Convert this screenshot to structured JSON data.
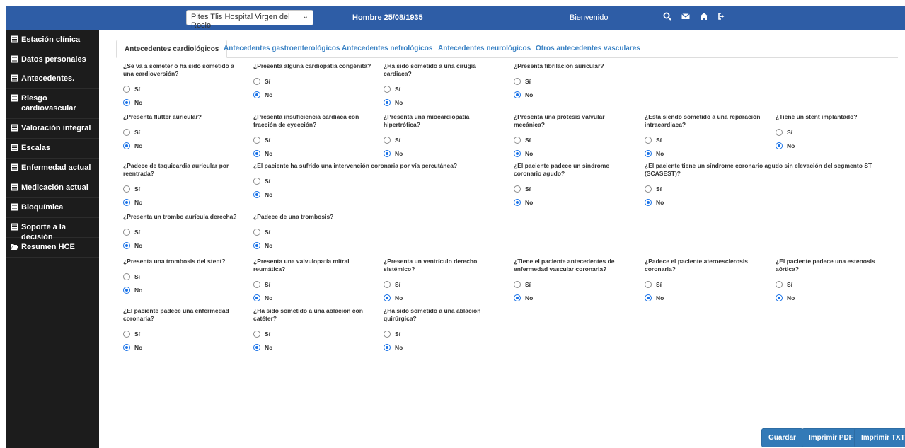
{
  "header": {
    "hospital_select": "Pites Tlis Hospital Virgen del Rocio",
    "patient": "Hombre 25/08/1935",
    "welcome": "Bienvenido",
    "icons": [
      "search-icon",
      "envelope-icon",
      "home-icon",
      "logout-icon"
    ]
  },
  "sidebar": {
    "items": [
      {
        "label": "Estación clínica"
      },
      {
        "label": "Datos personales"
      },
      {
        "label": "Antecedentes."
      },
      {
        "label": "Riesgo cardiovascular"
      },
      {
        "label": "Valoración integral"
      },
      {
        "label": "Escalas"
      },
      {
        "label": "Enfermedad actual"
      },
      {
        "label": "Medicación actual"
      },
      {
        "label": "Bioquímica"
      },
      {
        "label": "Soporte a la decisión"
      },
      {
        "label": "Resumen HCE"
      }
    ]
  },
  "tabs": [
    {
      "label": "Antecedentes cardiológicos",
      "active": true
    },
    {
      "label": "Antecedentes gastroenterológicos",
      "active": false
    },
    {
      "label": "Antecedentes nefrológicos",
      "active": false
    },
    {
      "label": "Antecedentes neurológicos",
      "active": false
    },
    {
      "label": "Otros antecedentes vasculares",
      "active": false
    }
  ],
  "options": {
    "yes": "Sí",
    "no": "No"
  },
  "questions": [
    {
      "text": "¿Se va a someter o ha sido sometido a una cardioversión?",
      "value": "No"
    },
    {
      "text": "¿Presenta alguna cardiopatía congénita?",
      "value": "No"
    },
    {
      "text": "¿Ha sido sometido a una cirugía cardiaca?",
      "value": "No"
    },
    {
      "text": "¿Presenta fibrilación auricular?",
      "value": "No"
    },
    {
      "text": "¿Presenta flutter auricular?",
      "value": "No"
    },
    {
      "text": "¿Presenta insuficiencia cardiaca con fracción de eyección?",
      "value": "No"
    },
    {
      "text": "¿Presenta una miocardiopatía hipertrófica?",
      "value": "No"
    },
    {
      "text": "¿Presenta una prótesis valvular mecánica?",
      "value": "No"
    },
    {
      "text": "¿Está siendo sometido a una reparación intracardiaca?",
      "value": "No"
    },
    {
      "text": "¿Tiene un stent implantado?",
      "value": "No"
    },
    {
      "text": "¿Padece de taquicardia auricular por reentrada?",
      "value": "No"
    },
    {
      "text": "¿El paciente ha sufrido una intervención coronaria por vía percutánea?",
      "value": "No"
    },
    {
      "text": "¿El paciente padece un síndrome coronario agudo?",
      "value": "No"
    },
    {
      "text": "¿El paciente tiene un síndrome coronario agudo sin elevación del segmento ST (SCASEST)?",
      "value": "No"
    },
    {
      "text": "¿Presenta un trombo aurícula derecha?",
      "value": "No"
    },
    {
      "text": "¿Padece de una trombosis?",
      "value": "No"
    },
    {
      "text": "¿Presenta una trombosis del stent?",
      "value": "No"
    },
    {
      "text": "¿Presenta una valvulopatía mitral reumática?",
      "value": "No"
    },
    {
      "text": "¿Presenta un ventrículo derecho sistémico?",
      "value": "No"
    },
    {
      "text": "¿Tiene el paciente antecedentes de enfermedad vascular coronaria?",
      "value": "No"
    },
    {
      "text": "¿Padece el paciente ateroesclerosis coronaria?",
      "value": "No"
    },
    {
      "text": "¿El paciente padece una estenosis aórtica?",
      "value": "No"
    },
    {
      "text": "¿El paciente padece una enfermedad coronaria?",
      "value": "No"
    },
    {
      "text": "¿Ha sido sometido a una ablación con catéter?",
      "value": "No"
    },
    {
      "text": "¿Ha sido sometido a una ablación quirúrgica?",
      "value": "No"
    }
  ],
  "buttons": {
    "save": "Guardar",
    "print_pdf": "Imprimir PDF",
    "print_txt": "Imprimir TXT"
  },
  "colors": {
    "header_bg": "#2e5da6",
    "sidebar_bg": "#1c1c1c",
    "tab_link": "#3a82c4",
    "button_bg": "#337ab7",
    "radio_checked": "#1a73e8"
  }
}
